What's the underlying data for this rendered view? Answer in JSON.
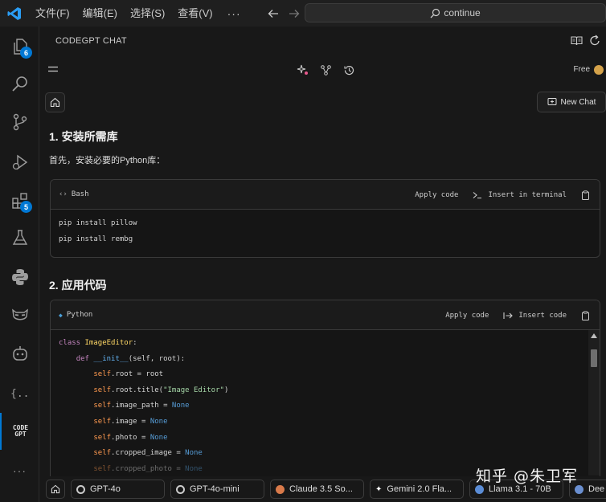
{
  "titlebar": {
    "menu": [
      "文件(F)",
      "编辑(E)",
      "选择(S)",
      "查看(V)"
    ],
    "more": "···",
    "search_text": "continue"
  },
  "activity": {
    "explorer_badge": "6",
    "extensions_badge": "5",
    "codegpt_logo": "CODE GPT",
    "more": "···"
  },
  "panel": {
    "title": "CODEGPT CHAT",
    "free_label": "Free",
    "new_chat_label": "New Chat"
  },
  "content": {
    "section1_title": "1. 安装所需库",
    "section1_text": "首先，安装必要的Python库：",
    "section2_title": "2. 应用代码",
    "bash_block": {
      "lang": "Bash",
      "apply": "Apply code",
      "insert": "Insert in terminal",
      "lines": [
        "pip install pillow",
        "pip install rembg"
      ]
    },
    "python_block": {
      "lang": "Python",
      "apply": "Apply code",
      "insert": "Insert code"
    }
  },
  "models": {
    "items": [
      "GPT-4o",
      "GPT-4o-mini",
      "Claude 3.5 So...",
      "Gemini 2.0 Fla...",
      "Llama 3.1 - 70B",
      "Dee"
    ]
  },
  "watermark": "知乎 @朱卫军"
}
